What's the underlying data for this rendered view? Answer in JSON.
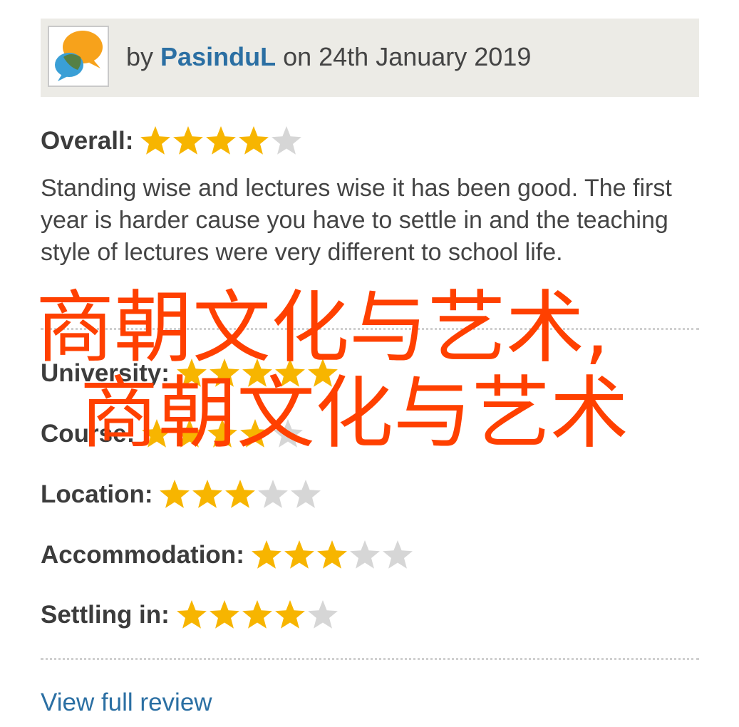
{
  "review": {
    "by_prefix": "by",
    "author": "PasinduL",
    "date_text": "on 24th January 2019",
    "text": "Standing wise and lectures wise it has been good. The first year is harder cause you have to settle in and the teaching style of lectures were very different to school life."
  },
  "ratings": [
    {
      "label": "Overall:",
      "value": 4,
      "max": 5
    },
    {
      "label": "University:",
      "value": 5,
      "max": 5
    },
    {
      "label": "Course:",
      "value": 4,
      "max": 5
    },
    {
      "label": "Location:",
      "value": 3,
      "max": 5
    },
    {
      "label": "Accommodation:",
      "value": 3,
      "max": 5
    },
    {
      "label": "Settling in:",
      "value": 4,
      "max": 5
    }
  ],
  "view_full_review": "View full review",
  "watermark": {
    "line1": "商朝文化与艺术,",
    "line2": "商朝文化与艺术"
  },
  "colors": {
    "star_filled": "#f7b500",
    "star_empty": "#d6d6d6",
    "link": "#2b6fa3",
    "watermark": "#ff4000",
    "header_bg": "#ecebe6"
  },
  "icons": {
    "avatar": "speech-bubbles-icon",
    "star": "star-icon"
  }
}
